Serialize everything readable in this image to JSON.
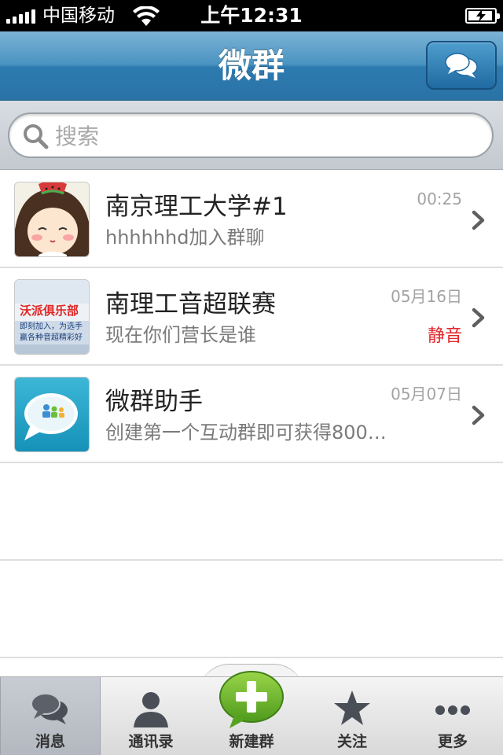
{
  "status_bar": {
    "carrier": "中国移动",
    "time": "上午12:31",
    "battery_level": 0.95
  },
  "nav": {
    "title": "微群",
    "right_icon": "chat-bubbles-icon"
  },
  "search": {
    "placeholder": "搜索",
    "value": ""
  },
  "groups": [
    {
      "name": "南京理工大学#1",
      "last_message": "hhhhhhd加入群聊",
      "time": "00:25",
      "badge": ""
    },
    {
      "name": "南理工音超联赛",
      "last_message": "现在你们营长是谁",
      "time": "05月16日",
      "badge": "静音",
      "avatar_text": "沃派俱乐部",
      "avatar_subtext": "即刻加入，为选手",
      "avatar_subtext2": "赢各种音超精彩好"
    },
    {
      "name": "微群助手",
      "last_message": "创建第一个互动群即可获得800…",
      "time": "05月07日",
      "badge": ""
    }
  ],
  "tabs": [
    {
      "label": "消息",
      "icon": "chat-bubbles-icon",
      "active": true
    },
    {
      "label": "通讯录",
      "icon": "person-icon",
      "active": false
    },
    {
      "label": "新建群",
      "icon": "plus-icon",
      "active": false
    },
    {
      "label": "关注",
      "icon": "star-icon",
      "active": false
    },
    {
      "label": "更多",
      "icon": "more-dots-icon",
      "active": false
    }
  ],
  "colors": {
    "nav_blue": "#2d7bb0",
    "mute_red": "#e0262a",
    "new_group_green": "#6cb32a"
  }
}
